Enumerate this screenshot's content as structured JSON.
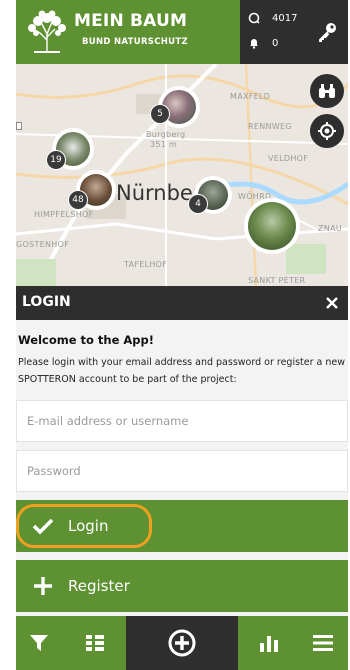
{
  "header": {
    "title": "MEIN BAUM",
    "subtitle": "BUND NATURSCHUTZ",
    "observations_count": "4017",
    "notifications_count": "0"
  },
  "map": {
    "city_label": "Nürnberg",
    "district_labels": [
      "MAXFELD",
      "RENNWEG",
      "VELDHOF",
      "WÖHRD",
      "ZNAU",
      "HIMPFELSHOF",
      "GOSTENHOF",
      "TAFELHOF",
      "Burgberg",
      "351 m",
      "SANKT PETER"
    ],
    "clusters": [
      {
        "count": "5"
      },
      {
        "count": "19"
      },
      {
        "count": "48"
      },
      {
        "count": "4"
      }
    ]
  },
  "login": {
    "bar_title": "LOGIN",
    "welcome": "Welcome to the App!",
    "description": "Please login with your email address and password or register a new SPOTTERON account to be part of the project:",
    "email_placeholder": "E-mail address or username",
    "password_placeholder": "Password",
    "login_label": "Login",
    "register_label": "Register"
  },
  "colors": {
    "brand_green": "#5e9131",
    "dark": "#2e2e2e",
    "highlight": "#f0a020"
  },
  "icons": [
    "tree-logo-icon",
    "observation-icon",
    "bell-icon",
    "key-icon",
    "binoculars-icon",
    "locate-icon",
    "close-icon",
    "check-icon",
    "plus-icon",
    "filter-icon",
    "list-icon",
    "add-spot-icon",
    "chart-icon",
    "menu-icon"
  ]
}
